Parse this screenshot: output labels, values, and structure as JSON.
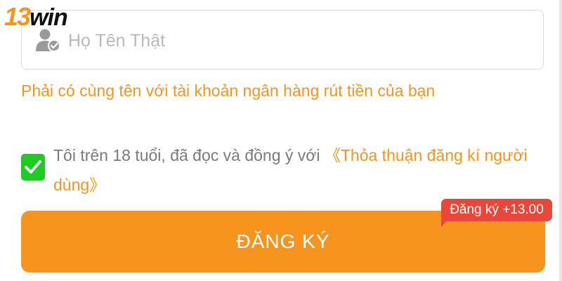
{
  "logo": {
    "number": "13",
    "word": "win"
  },
  "name_field": {
    "placeholder": "Họ Tên Thật",
    "icon": "user-check-icon",
    "hint": "Phải có cùng tên với tài khoản ngân hàng rút tiền của bạn"
  },
  "agreement": {
    "checked": true,
    "text": "Tôi trên 18 tuổi, đã đọc và đồng ý với ",
    "link_label": "《Thỏa thuận đăng kí người dùng》"
  },
  "register": {
    "button_label": "ĐĂNG KÝ",
    "bonus_badge": "Đăng ký +13.00"
  },
  "colors": {
    "brand_orange": "#f7941d",
    "checkbox_green": "#1fca23",
    "badge_red": "#e8473a",
    "hint_orange": "#f7941d"
  }
}
